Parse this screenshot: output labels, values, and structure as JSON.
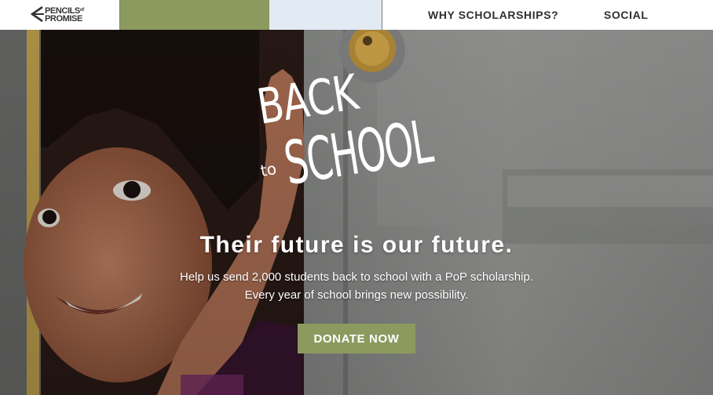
{
  "brand": {
    "line1": "PENCILS",
    "sup": "of",
    "line2": "PROMISE"
  },
  "nav": {
    "links": [
      {
        "label": "WHY SCHOLARSHIPS?"
      },
      {
        "label": "SOCIAL"
      }
    ]
  },
  "colors": {
    "accent": "#8d9a5f",
    "nav_blue": "#e2ebf3",
    "text_dark": "#2f2f2f"
  },
  "hero": {
    "title_art": {
      "line1": "BACK",
      "connector": "to",
      "line2": "SCHOOL"
    },
    "headline": "Their future is our future.",
    "subtext_line1": "Help us send 2,000 students back to school with a PoP scholarship.",
    "subtext_line2": "Every year of school brings new possibility.",
    "cta_label": "DONATE NOW"
  }
}
